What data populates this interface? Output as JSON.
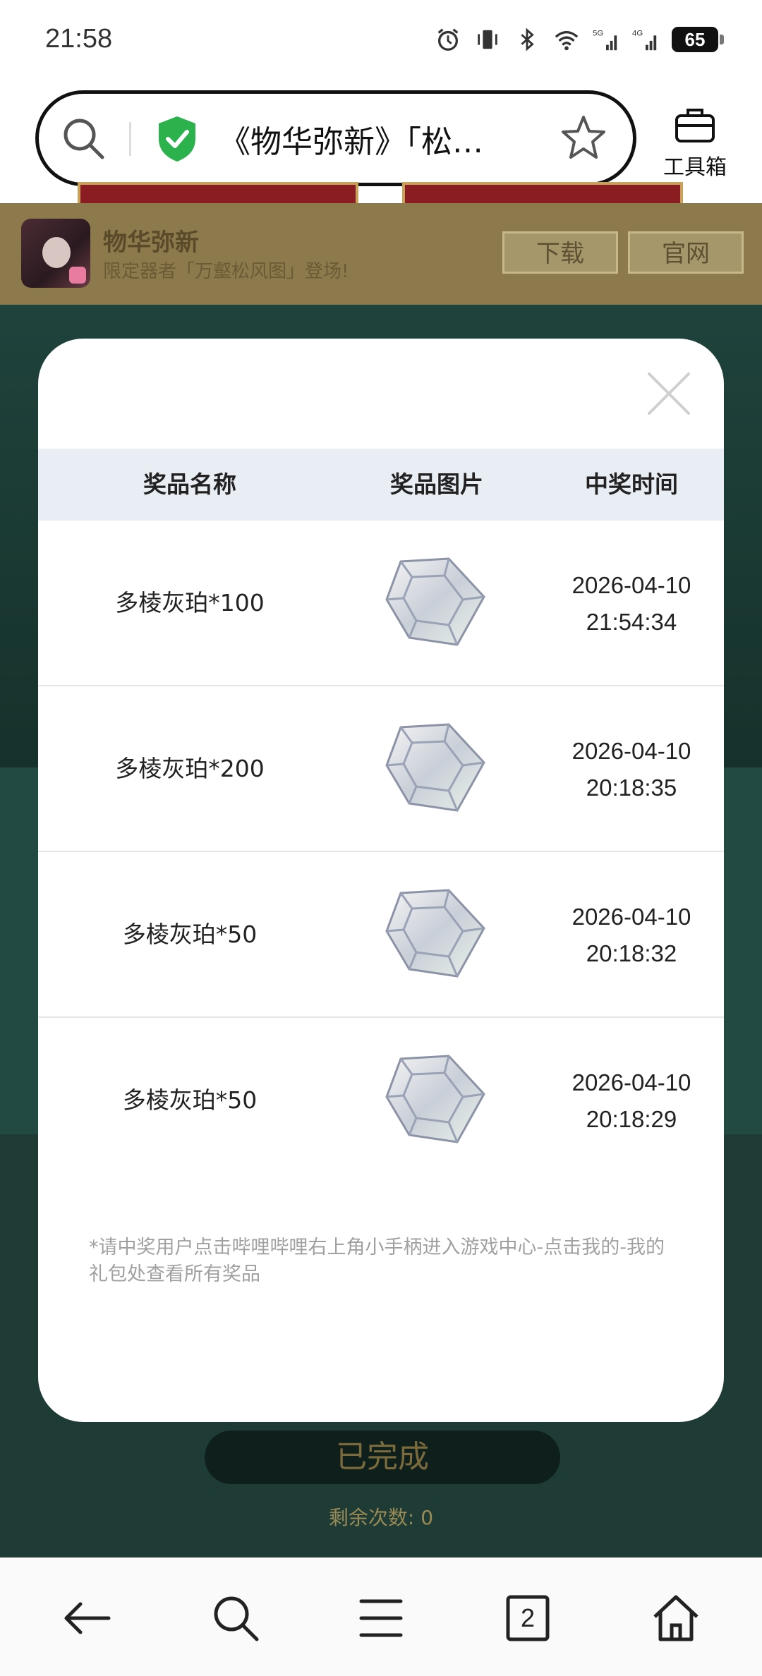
{
  "status": {
    "time": "21:58",
    "battery": "65"
  },
  "address_bar": {
    "url_text": "《物华弥新》「松…"
  },
  "toolbox": {
    "label": "工具箱"
  },
  "app_banner": {
    "name": "物华弥新",
    "desc": "限定器者「万壑松风图」登场!",
    "download": "下载",
    "official": "官网"
  },
  "page": {
    "done_button": "已完成",
    "remain_label": "剩余次数:",
    "remain_value": "0"
  },
  "modal": {
    "headers": {
      "name": "奖品名称",
      "image": "奖品图片",
      "time": "中奖时间"
    },
    "rows": [
      {
        "name": "多棱灰珀*100",
        "date": "2026-04-10",
        "time": "21:54:34"
      },
      {
        "name": "多棱灰珀*200",
        "date": "2026-04-10",
        "time": "20:18:35"
      },
      {
        "name": "多棱灰珀*50",
        "date": "2026-04-10",
        "time": "20:18:32"
      },
      {
        "name": "多棱灰珀*50",
        "date": "2026-04-10",
        "time": "20:18:29"
      }
    ],
    "note": "*请中奖用户点击哔哩哔哩右上角小手柄进入游戏中心-点击我的-我的礼包处查看所有奖品"
  },
  "bottom_nav": {
    "tabs_count": "2"
  },
  "colors": {
    "accent_green": "#2bb24c",
    "page_bg": "#1f3b36",
    "banner": "#8d7a4c"
  }
}
